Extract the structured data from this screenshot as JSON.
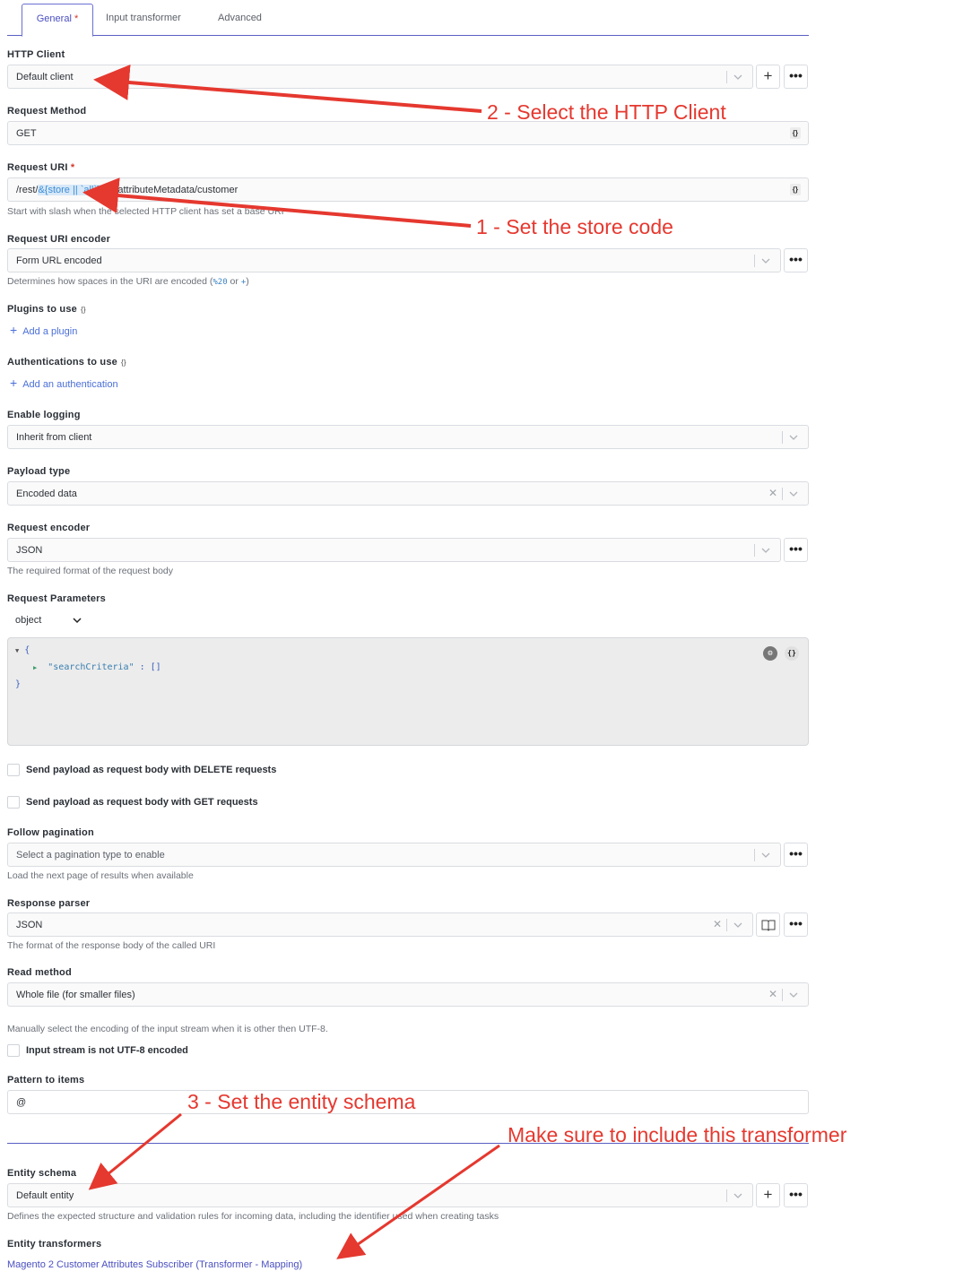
{
  "tabs": [
    {
      "label": "General",
      "required_mark": "*"
    },
    {
      "label": "Input transformer"
    },
    {
      "label": "Advanced"
    }
  ],
  "http_client": {
    "label": "HTTP Client",
    "value": "Default client"
  },
  "request_method": {
    "label": "Request Method",
    "value": "GET"
  },
  "request_uri": {
    "label": "Request URI",
    "required_mark": "*",
    "value_prefix": "/rest/",
    "value_highlight": "&{store || `all`}",
    "value_suffix": "/V1/attributeMetadata/customer",
    "help": "Start with slash when the selected HTTP client has set a base URI"
  },
  "uri_encoder": {
    "label": "Request URI encoder",
    "value": "Form URL encoded",
    "help_prefix": "Determines how spaces in the URI are encoded (",
    "help_code1": "%20",
    "help_or": " or ",
    "help_code2": "+",
    "help_suffix": ")"
  },
  "plugins": {
    "label": "Plugins to use",
    "braces": "{}",
    "add_label": "Add a plugin"
  },
  "authentications": {
    "label": "Authentications to use",
    "braces": "{}",
    "add_label": "Add an authentication"
  },
  "logging": {
    "label": "Enable logging",
    "value": "Inherit from client"
  },
  "payload_type": {
    "label": "Payload type",
    "value": "Encoded data"
  },
  "request_encoder": {
    "label": "Request encoder",
    "value": "JSON",
    "help": "The required format of the request body"
  },
  "request_parameters": {
    "label": "Request Parameters",
    "type_value": "object",
    "code_open": "{",
    "code_key": "\"searchCriteria\"",
    "code_rest": " : []",
    "code_close": "}"
  },
  "checkboxes": {
    "delete_body": "Send payload as request body with DELETE requests",
    "get_body": "Send payload as request body with GET requests"
  },
  "pagination": {
    "label": "Follow pagination",
    "placeholder": "Select a pagination type to enable",
    "help": "Load the next page of results when available"
  },
  "response_parser": {
    "label": "Response parser",
    "value": "JSON",
    "help": "The format of the response body of the called URI"
  },
  "read_method": {
    "label": "Read method",
    "value": "Whole file (for smaller files)",
    "help": "Manually select the encoding of the input stream when it is other then UTF-8."
  },
  "utf8_checkbox": "Input stream is not UTF-8 encoded",
  "pattern_items": {
    "label": "Pattern to items",
    "value": "@"
  },
  "entity_schema": {
    "label": "Entity schema",
    "value": "Default entity",
    "help": "Defines the expected structure and validation rules for incoming data, including the identifier used when creating tasks"
  },
  "entity_transformers": {
    "label": "Entity transformers",
    "item": "Magento 2 Customer Attributes Subscriber (Transformer - Mapping)"
  },
  "annotations": {
    "a1": "2 - Select the HTTP Client",
    "a2": "1 - Set the store code",
    "a3": "3 - Set the entity schema",
    "a4": "Make sure to include this transformer"
  },
  "colors": {
    "accent": "#4a4fc0",
    "annotation": "#e5382f",
    "link": "#4a6fd8"
  }
}
